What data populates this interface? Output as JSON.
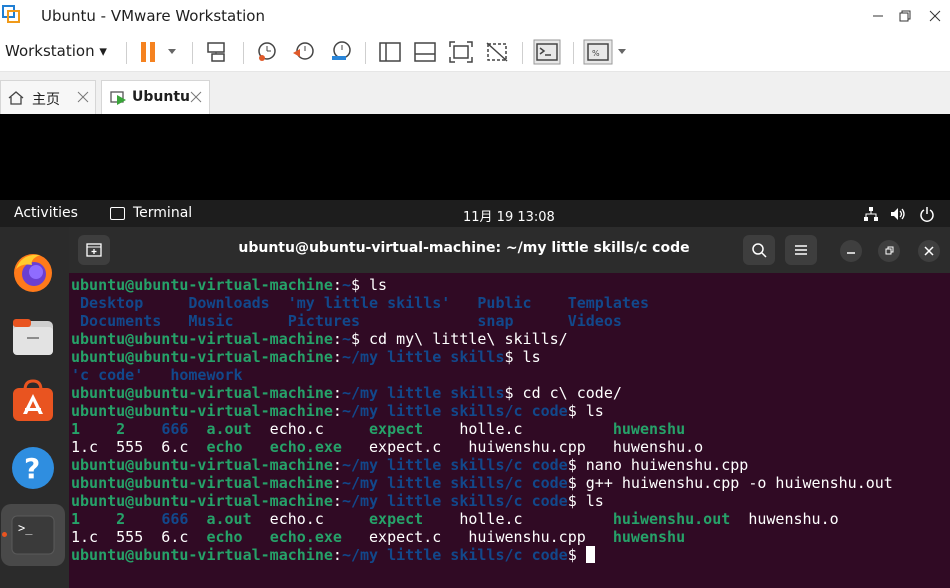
{
  "window": {
    "title": "Ubuntu - VMware Workstation",
    "icon": "vmware-icon"
  },
  "toolbar": {
    "workstation_menu": "Workstation",
    "icons": [
      "pause-icon",
      "send-keys-icon",
      "snapshot-icon",
      "revert-snapshot-icon",
      "snapshot-manager-icon",
      "library-icon",
      "console-view-icon",
      "fullscreen-icon",
      "unity-icon",
      "terminal-icon",
      "stretch-icon"
    ]
  },
  "tabs": [
    {
      "label": "主页",
      "icon": "home-icon"
    },
    {
      "label": "Ubuntu",
      "icon": "vm-icon"
    }
  ],
  "gnome": {
    "activities": "Activities",
    "app_name": "Terminal",
    "clock": "11月 19  13:08"
  },
  "dock": [
    "firefox-icon",
    "files-icon",
    "software-icon",
    "help-icon",
    "terminal-icon"
  ],
  "terminal": {
    "title": "ubuntu@ubuntu-virtual-machine: ~/my little skills/c code",
    "lines": [
      [
        [
          "u",
          "ubuntu@ubuntu-virtual-machine"
        ],
        [
          "w",
          ":"
        ],
        [
          "p",
          "~"
        ],
        [
          "w",
          "$ ls"
        ]
      ],
      [
        [
          "d",
          " Desktop     Downloads  'my little skills'   Public    Templates"
        ]
      ],
      [
        [
          "d",
          " Documents   Music      Pictures             snap      Videos"
        ]
      ],
      [
        [
          "u",
          "ubuntu@ubuntu-virtual-machine"
        ],
        [
          "w",
          ":"
        ],
        [
          "p",
          "~"
        ],
        [
          "w",
          "$ cd my\\ little\\ skills/"
        ]
      ],
      [
        [
          "u",
          "ubuntu@ubuntu-virtual-machine"
        ],
        [
          "w",
          ":"
        ],
        [
          "p",
          "~/my little skills"
        ],
        [
          "w",
          "$ ls"
        ]
      ],
      [
        [
          "d",
          "'c code'"
        ],
        [
          "w",
          "   "
        ],
        [
          "d",
          "homework"
        ]
      ],
      [
        [
          "u",
          "ubuntu@ubuntu-virtual-machine"
        ],
        [
          "w",
          ":"
        ],
        [
          "p",
          "~/my little skills"
        ],
        [
          "w",
          "$ cd c\\ code/"
        ]
      ],
      [
        [
          "u",
          "ubuntu@ubuntu-virtual-machine"
        ],
        [
          "w",
          ":"
        ],
        [
          "p",
          "~/my little skills/c code"
        ],
        [
          "w",
          "$ ls"
        ]
      ],
      [
        [
          "x",
          "1"
        ],
        [
          "w",
          "    "
        ],
        [
          "x",
          "2"
        ],
        [
          "w",
          "    "
        ],
        [
          "d",
          "666"
        ],
        [
          "w",
          "  "
        ],
        [
          "x",
          "a.out"
        ],
        [
          "w",
          "  echo.c     "
        ],
        [
          "x",
          "expect"
        ],
        [
          "w",
          "    holle.c          "
        ],
        [
          "x",
          "huwenshu"
        ]
      ],
      [
        [
          "w",
          "1.c  555  6.c  "
        ],
        [
          "x",
          "echo"
        ],
        [
          "w",
          "   "
        ],
        [
          "x",
          "echo.exe"
        ],
        [
          "w",
          "   expect.c   huiwenshu.cpp   huwenshu.o"
        ]
      ],
      [
        [
          "u",
          "ubuntu@ubuntu-virtual-machine"
        ],
        [
          "w",
          ":"
        ],
        [
          "p",
          "~/my little skills/c code"
        ],
        [
          "w",
          "$ nano huiwenshu.cpp"
        ]
      ],
      [
        [
          "u",
          "ubuntu@ubuntu-virtual-machine"
        ],
        [
          "w",
          ":"
        ],
        [
          "p",
          "~/my little skills/c code"
        ],
        [
          "w",
          "$ g++ huiwenshu.cpp -o huiwenshu.out"
        ]
      ],
      [
        [
          "u",
          "ubuntu@ubuntu-virtual-machine"
        ],
        [
          "w",
          ":"
        ],
        [
          "p",
          "~/my little skills/c code"
        ],
        [
          "w",
          "$ ls"
        ]
      ],
      [
        [
          "x",
          "1"
        ],
        [
          "w",
          "    "
        ],
        [
          "x",
          "2"
        ],
        [
          "w",
          "    "
        ],
        [
          "d",
          "666"
        ],
        [
          "w",
          "  "
        ],
        [
          "x",
          "a.out"
        ],
        [
          "w",
          "  echo.c     "
        ],
        [
          "x",
          "expect"
        ],
        [
          "w",
          "    holle.c          "
        ],
        [
          "x",
          "huiwenshu.out"
        ],
        [
          "w",
          "  huwenshu.o"
        ]
      ],
      [
        [
          "w",
          "1.c  555  6.c  "
        ],
        [
          "x",
          "echo"
        ],
        [
          "w",
          "   "
        ],
        [
          "x",
          "echo.exe"
        ],
        [
          "w",
          "   expect.c   huiwenshu.cpp   "
        ],
        [
          "x",
          "huwenshu"
        ]
      ],
      [
        [
          "u",
          "ubuntu@ubuntu-virtual-machine"
        ],
        [
          "w",
          ":"
        ],
        [
          "p",
          "~/my little skills/c code"
        ],
        [
          "w",
          "$ "
        ],
        [
          "c",
          ""
        ]
      ]
    ]
  },
  "colors": {
    "terminal_bg": "#300a24",
    "prompt_user": "#26a269",
    "prompt_path": "#12488b",
    "pause_orange": "#f58220"
  }
}
